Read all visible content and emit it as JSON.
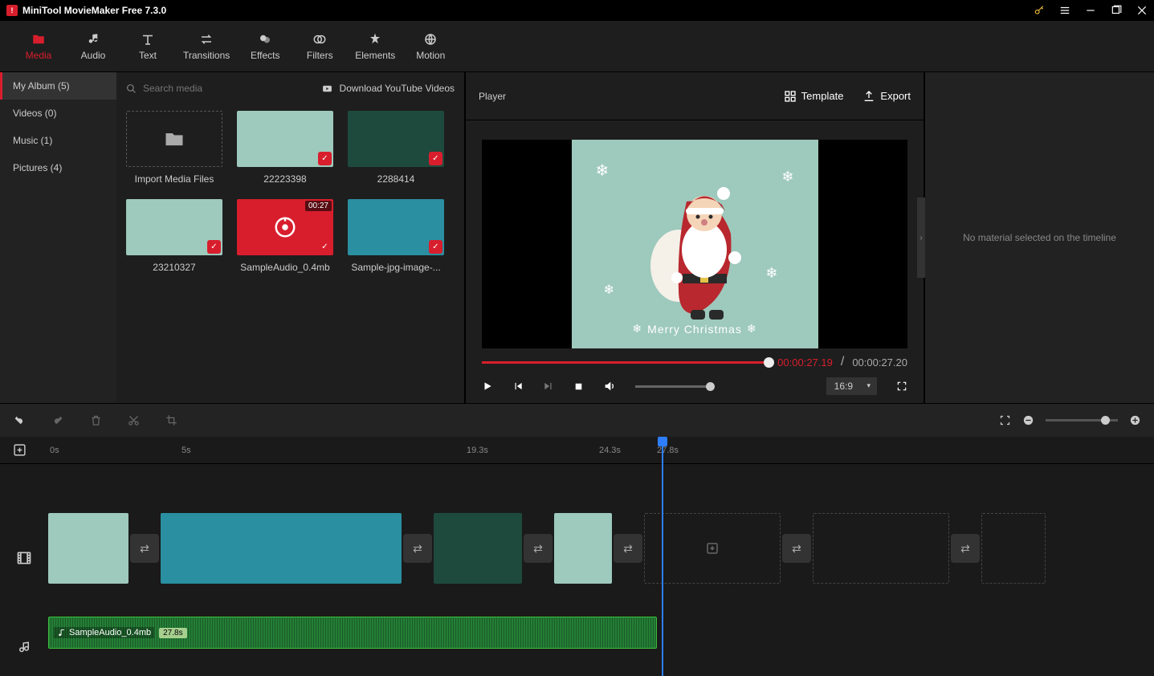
{
  "title_bar": {
    "app_title": "MiniTool MovieMaker Free 7.3.0"
  },
  "top_tabs": [
    {
      "label": "Media",
      "icon": "folder",
      "active": true
    },
    {
      "label": "Audio",
      "icon": "music",
      "active": false
    },
    {
      "label": "Text",
      "icon": "text",
      "active": false
    },
    {
      "label": "Transitions",
      "icon": "swap",
      "active": false
    },
    {
      "label": "Effects",
      "icon": "sparkle",
      "active": false
    },
    {
      "label": "Filters",
      "icon": "overlap",
      "active": false
    },
    {
      "label": "Elements",
      "icon": "star",
      "active": false
    },
    {
      "label": "Motion",
      "icon": "globe",
      "active": false
    }
  ],
  "sidebar": {
    "items": [
      {
        "label": "My Album (5)",
        "active": true
      },
      {
        "label": "Videos (0)",
        "active": false
      },
      {
        "label": "Music (1)",
        "active": false
      },
      {
        "label": "Pictures (4)",
        "active": false
      }
    ]
  },
  "media": {
    "search_placeholder": "Search media",
    "youtube_link": "Download YouTube Videos",
    "import_label": "Import Media Files",
    "items": [
      {
        "label": "22223398",
        "checked": true
      },
      {
        "label": "2288414",
        "checked": true
      },
      {
        "label": "23210327",
        "checked": true
      },
      {
        "label": "SampleAudio_0.4mb",
        "checked": true,
        "duration": "00:27",
        "audio": true
      },
      {
        "label": "Sample-jpg-image-...",
        "checked": true
      }
    ]
  },
  "player": {
    "header_title": "Player",
    "template_btn": "Template",
    "export_btn": "Export",
    "preview_caption": "Merry Christmas",
    "time_current": "00:00:27.19",
    "time_total": "00:00:27.20",
    "aspect": "16:9"
  },
  "right_panel": {
    "message": "No material selected on the timeline"
  },
  "timeline": {
    "ruler": [
      "0s",
      "5s",
      "19.3s",
      "24.3s",
      "27.8s"
    ],
    "ruler_positions": [
      62,
      226,
      581,
      746,
      818
    ],
    "audio_clip": {
      "label": "SampleAudio_0.4mb",
      "duration": "27.8s"
    }
  }
}
